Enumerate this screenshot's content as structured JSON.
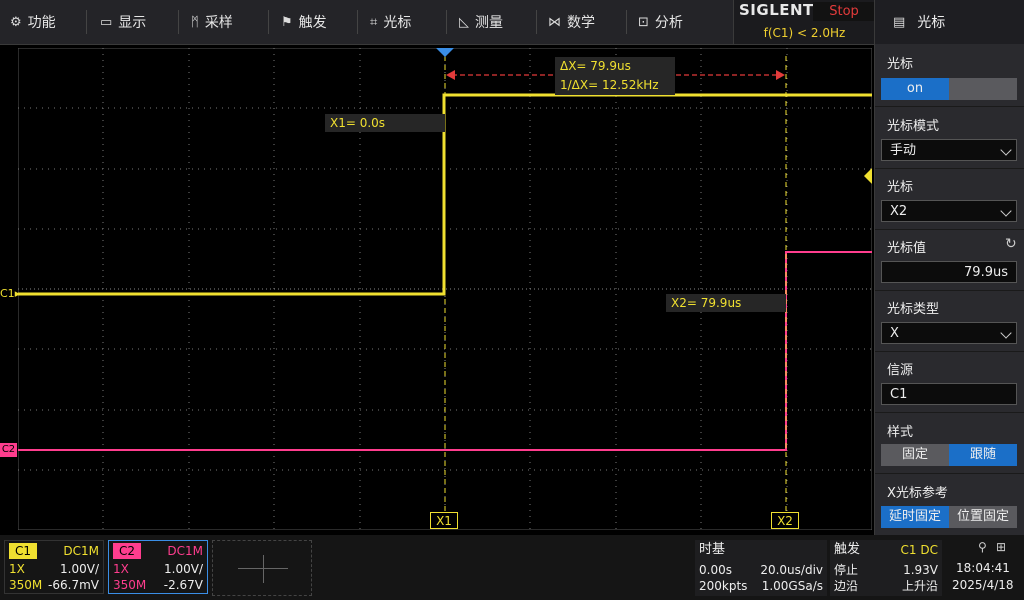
{
  "menu": [
    {
      "label": "功能",
      "icon": "gear-icon"
    },
    {
      "label": "显示",
      "icon": "monitor-icon"
    },
    {
      "label": "采样",
      "icon": "acquire-icon"
    },
    {
      "label": "触发",
      "icon": "flag-icon"
    },
    {
      "label": "光标",
      "icon": "crosshair-icon"
    },
    {
      "label": "测量",
      "icon": "measure-icon"
    },
    {
      "label": "数学",
      "icon": "math-icon"
    },
    {
      "label": "分析",
      "icon": "analysis-icon"
    }
  ],
  "brand": {
    "logo": "SIGLENT",
    "run_state": "Stop",
    "freq": "f(C1) < 2.0Hz"
  },
  "panel": {
    "title": "光标",
    "cursor_label": "光标",
    "cursor_on": "on",
    "mode_label": "光标模式",
    "mode_value": "手动",
    "select_label": "光标",
    "select_value": "X2",
    "value_label": "光标值",
    "value_value": "79.9us",
    "type_label": "光标类型",
    "type_value": "X",
    "source_label": "信源",
    "source_value": "C1",
    "style_label": "样式",
    "style_fixed": "固定",
    "style_track": "跟随",
    "xref_label": "X光标参考",
    "xref_delay": "延时固定",
    "xref_position": "位置固定"
  },
  "scope": {
    "delta_x": "ΔX= 79.9us",
    "inv_delta_x": "1/ΔX= 12.52kHz",
    "x1_readout": "X1= 0.0s",
    "x2_readout": "X2= 79.9us",
    "x1_tag": "X1",
    "x2_tag": "X2",
    "c1_marker": "C1",
    "c2_marker": "C2"
  },
  "channels": {
    "c1": {
      "name": "C1",
      "coupling": "DC1M",
      "probe": "1X",
      "scale": "1.00V/",
      "bw": "350M",
      "offset": "-66.7mV"
    },
    "c2": {
      "name": "C2",
      "coupling": "DC1M",
      "probe": "1X",
      "scale": "1.00V/",
      "bw": "350M",
      "offset": "-2.67V"
    }
  },
  "timebase": {
    "title": "时基",
    "delay": "0.00s",
    "scale": "20.0us/div",
    "points": "200kpts",
    "rate": "1.00GSa/s"
  },
  "trigger": {
    "title": "触发",
    "source": "C1 DC",
    "mode": "停止",
    "level": "1.93V",
    "type": "边沿",
    "slope": "上升沿"
  },
  "status": {
    "time": "18:04:41",
    "date": "2025/4/18"
  },
  "colors": {
    "c1": "#f0e030",
    "c2": "#ff3d8e",
    "cursor_delta": "#e33b3b",
    "accent": "#1b6fc8"
  }
}
